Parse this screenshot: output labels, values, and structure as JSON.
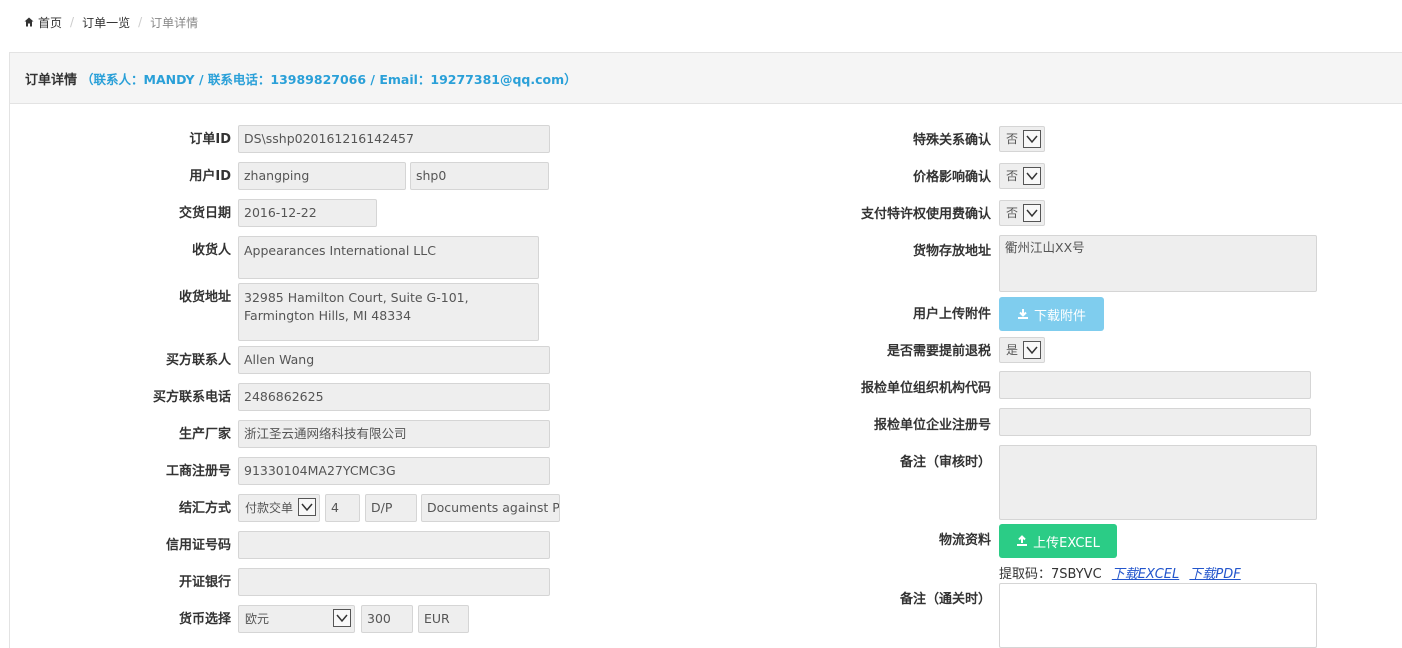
{
  "breadcrumb": {
    "home": "首页",
    "list": "订单一览",
    "current": "订单详情"
  },
  "panel": {
    "title": "订单详情",
    "contact": "（联系人：MANDY / 联系电话：13989827066 / Email：19277381@qq.com）"
  },
  "left": {
    "order_id": {
      "label": "订单ID",
      "value": "DS\\sshp020161216142457"
    },
    "user_id": {
      "label": "用户ID",
      "value": "zhangping",
      "value2": "shp0"
    },
    "delivery_date": {
      "label": "交货日期",
      "value": "2016-12-22"
    },
    "consignee": {
      "label": "收货人",
      "value": "Appearances International LLC"
    },
    "address": {
      "label": "收货地址",
      "value": "32985 Hamilton Court, Suite G-101, Farmington Hills, MI 48334"
    },
    "buyer_contact": {
      "label": "买方联系人",
      "value": "Allen Wang"
    },
    "buyer_phone": {
      "label": "买方联系电话",
      "value": "2486862625"
    },
    "manufacturer": {
      "label": "生产厂家",
      "value": "浙江圣云通网络科技有限公司"
    },
    "business_reg": {
      "label": "工商注册号",
      "value": "91330104MA27YCMC3G"
    },
    "settlement": {
      "label": "结汇方式",
      "select": "付款交单",
      "days": "4",
      "code": "D/P",
      "desc": "Documents against Pa"
    },
    "lc_number": {
      "label": "信用证号码",
      "value": ""
    },
    "issuing_bank": {
      "label": "开证银行",
      "value": ""
    },
    "currency": {
      "label": "货币选择",
      "select": "欧元",
      "rate": "300",
      "code": "EUR"
    }
  },
  "right": {
    "special_relation": {
      "label": "特殊关系确认",
      "value": "否"
    },
    "price_effect": {
      "label": "价格影响确认",
      "value": "否"
    },
    "royalty": {
      "label": "支付特许权使用费确认",
      "value": "否"
    },
    "storage_address": {
      "label": "货物存放地址",
      "value": "衢州江山XX号"
    },
    "attachment": {
      "label": "用户上传附件",
      "button": "下载附件"
    },
    "tax_refund": {
      "label": "是否需要提前退税",
      "value": "是"
    },
    "inspection_org_code": {
      "label": "报检单位组织机构代码",
      "value": ""
    },
    "inspection_reg_no": {
      "label": "报检单位企业注册号",
      "value": ""
    },
    "remark_review": {
      "label": "备注（审核时）",
      "value": ""
    },
    "logistics": {
      "label": "物流资料",
      "button": "上传EXCEL",
      "pickup_label": "提取码：7SBYVC",
      "download_excel": "下载EXCEL",
      "download_pdf": "下载PDF"
    },
    "remark_customs": {
      "label": "备注（通关时）",
      "value": ""
    }
  },
  "colors": {
    "link": "#2aa0d8",
    "green": "#2bcc86",
    "light_blue": "#7fcdee"
  }
}
